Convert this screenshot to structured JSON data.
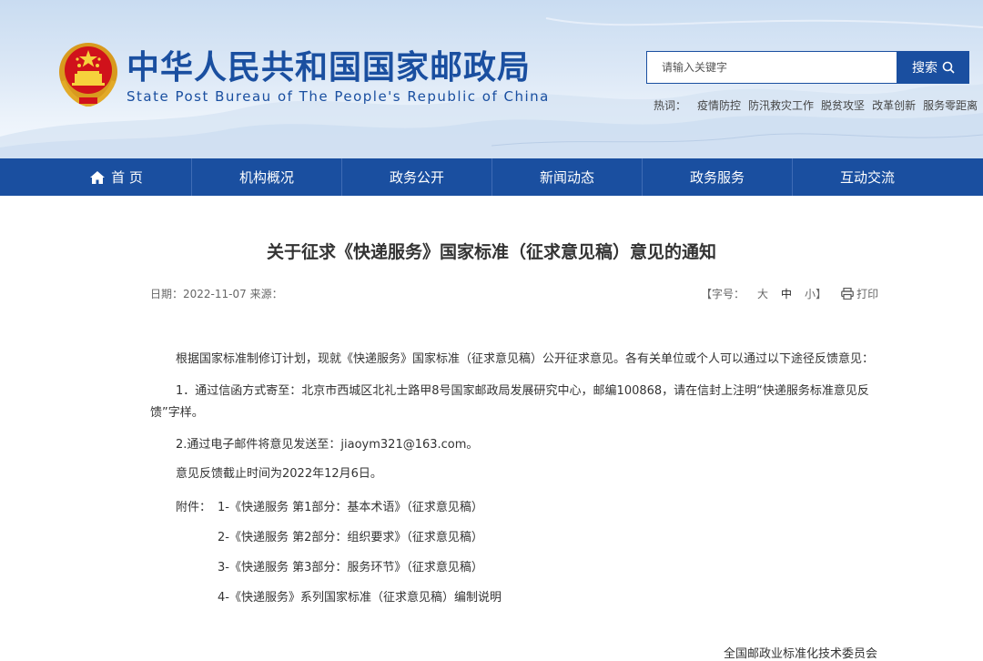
{
  "header": {
    "title_cn": "中华人民共和国国家邮政局",
    "title_en": "State Post Bureau of The People's Republic of China",
    "search": {
      "placeholder": "请输入关键字",
      "button_label": "搜索"
    },
    "hotwords": {
      "label": "热词：",
      "items": [
        "疫情防控",
        "防汛救灾工作",
        "脱贫攻坚",
        "改革创新",
        "服务零距离"
      ]
    }
  },
  "nav": {
    "items": [
      {
        "label": "首 页",
        "icon": "home-icon"
      },
      {
        "label": "机构概况"
      },
      {
        "label": "政务公开"
      },
      {
        "label": "新闻动态"
      },
      {
        "label": "政务服务"
      },
      {
        "label": "互动交流"
      }
    ]
  },
  "article": {
    "title": "关于征求《快递服务》国家标准（征求意见稿）意见的通知",
    "meta": {
      "date_label": "日期：",
      "date": "2022-11-07",
      "source_label": "来源：",
      "fontsize_open": "【字号：",
      "fontsize_large": "大",
      "fontsize_medium": "中",
      "fontsize_small": "小",
      "fontsize_close": "】",
      "print": "打印"
    },
    "paragraphs": [
      "根据国家标准制修订计划，现就《快递服务》国家标准（征求意见稿）公开征求意见。各有关单位或个人可以通过以下途径反馈意见：",
      "1．通过信函方式寄至：北京市西城区北礼士路甲8号国家邮政局发展研究中心，邮编100868，请在信封上注明“快递服务标准意见反馈”字样。",
      "2.通过电子邮件将意见发送至：jiaoym321@163.com。",
      "意见反馈截止时间为2022年12月6日。"
    ],
    "attachments_label": "附件：",
    "attachments": [
      "1-《快递服务 第1部分：基本术语》（征求意见稿）",
      "2-《快递服务 第2部分：组织要求》（征求意见稿）",
      "3-《快递服务 第3部分：服务环节》（征求意见稿）",
      "4-《快递服务》系列国家标准（征求意见稿）编制说明"
    ],
    "signature": "全国邮政业标准化技术委员会"
  },
  "colors": {
    "brand_blue": "#1a4fa0",
    "nav_divider": "#3f6cb5",
    "text": "#333333"
  }
}
